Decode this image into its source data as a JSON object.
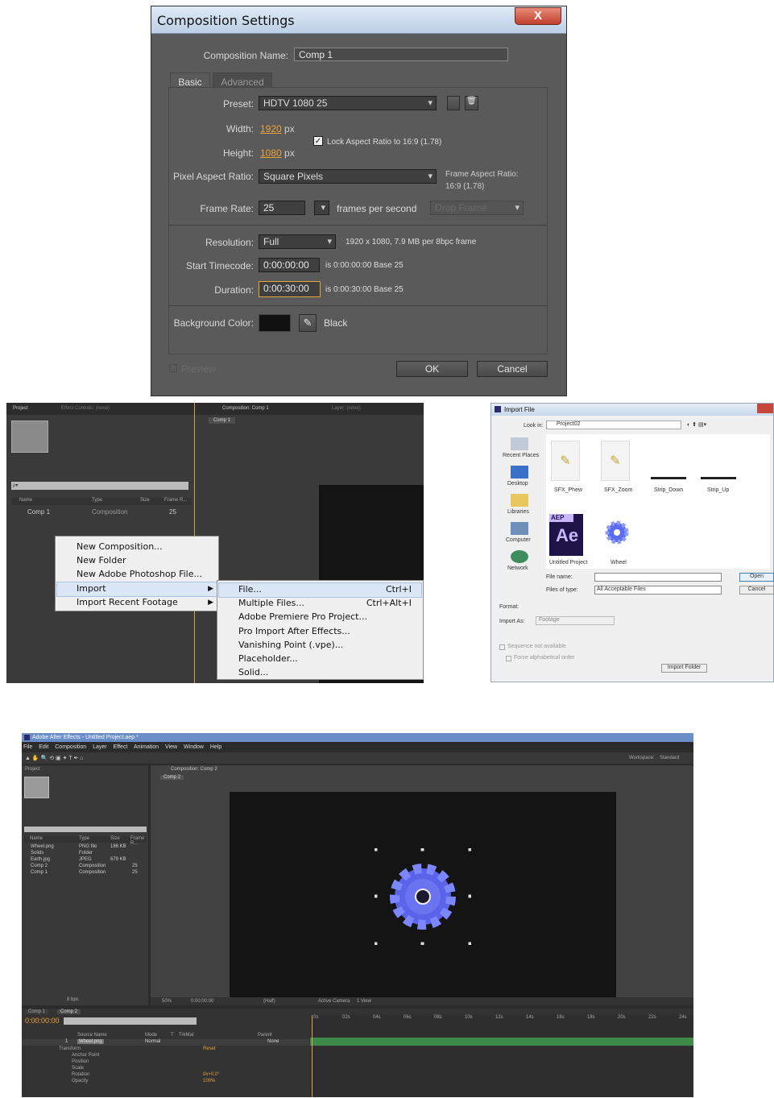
{
  "comp_settings": {
    "title": "Composition Settings",
    "close": "X",
    "comp_name_label": "Composition Name:",
    "comp_name_value": "Comp 1",
    "tabs": [
      "Basic",
      "Advanced"
    ],
    "preset_label": "Preset:",
    "preset_value": "HDTV 1080 25",
    "width_label": "Width:",
    "width_value": "1920",
    "height_label": "Height:",
    "height_value": "1080",
    "px": "px",
    "lock_aspect": "Lock Aspect Ratio to 16:9 (1.78)",
    "par_label": "Pixel Aspect Ratio:",
    "par_value": "Square Pixels",
    "frame_aspect_label": "Frame Aspect Ratio:",
    "frame_aspect_value": "16:9 (1.78)",
    "frame_rate_label": "Frame Rate:",
    "frame_rate_value": "25",
    "fps_label": "frames per second",
    "drop_frame": "Drop Frame",
    "resolution_label": "Resolution:",
    "resolution_value": "Full",
    "resolution_info": "1920 x 1080, 7.9 MB per 8bpc frame",
    "start_tc_label": "Start Timecode:",
    "start_tc_value": "0:00:00:00",
    "start_tc_info": "is 0:00:00:00  Base 25",
    "duration_label": "Duration:",
    "duration_value": "0:00:30:00",
    "duration_info": "is 0:00:30:00  Base 25",
    "bg_label": "Background Color:",
    "bg_name": "Black",
    "preview": "Preview",
    "ok": "OK",
    "cancel": "Cancel"
  },
  "project_panel": {
    "tab_project": "Project",
    "tab_effect": "Effect Controls: (none)",
    "tab_comp": "Composition: Comp 1",
    "tab_layer": "Layer: (none)",
    "comp_chip": "Comp 1",
    "search": "ρ▾",
    "cols": [
      "Name",
      "Type",
      "Size",
      "Frame R..."
    ],
    "row": {
      "name": "Comp 1",
      "type": "Composition",
      "fr": "25"
    }
  },
  "context_menu": {
    "items": [
      "New Composition...",
      "New Folder",
      "New Adobe Photoshop File...",
      "Import",
      "Import Recent Footage"
    ]
  },
  "import_submenu": {
    "items": [
      {
        "label": "File...",
        "shortcut": "Ctrl+I"
      },
      {
        "label": "Multiple Files...",
        "shortcut": "Ctrl+Alt+I"
      },
      {
        "label": "Adobe Premiere Pro Project...",
        "shortcut": ""
      },
      {
        "label": "Pro Import After Effects...",
        "shortcut": ""
      },
      {
        "label": "Vanishing Point (.vpe)...",
        "shortcut": ""
      },
      {
        "label": "Placeholder...",
        "shortcut": ""
      },
      {
        "label": "Solid...",
        "shortcut": ""
      }
    ]
  },
  "import_dialog": {
    "title": "Import File",
    "look_in_label": "Look in:",
    "look_in_value": "Project02",
    "places": [
      "Recent Places",
      "Desktop",
      "Libraries",
      "Computer",
      "Network"
    ],
    "files": [
      "SFX_Phew",
      "SFX_Zoom",
      "Strip_Down",
      "Strip_Up",
      "Untitled Project",
      "Wheel"
    ],
    "aep_label": "AEP",
    "ae_label": "Ae",
    "file_name_label": "File name:",
    "files_of_type_label": "Files of type:",
    "files_of_type_value": "All Acceptable Files",
    "open": "Open",
    "cancel": "Cancel",
    "format_label": "Format:",
    "import_as_label": "Import As:",
    "import_as_value": "Footage",
    "sequence": "Sequence not available",
    "force_alpha": "Force alphabetical order",
    "import_folder": "Import Folder"
  },
  "ae_app": {
    "title": "Adobe After Effects - Untitled Project.aep *",
    "menu": [
      "File",
      "Edit",
      "Composition",
      "Layer",
      "Effect",
      "Animation",
      "View",
      "Window",
      "Help"
    ],
    "workspace_label": "Workspace:",
    "workspace_value": "Standard",
    "project_tab": "Project",
    "comp_tab": "Composition: Comp 2",
    "comp_chip": "Comp 2",
    "cols": [
      "Name",
      "Type",
      "Size",
      "Frame R..."
    ],
    "rows": [
      {
        "name": "Wheel.png",
        "type": "PNG file",
        "size": "186 KB",
        "fr": ""
      },
      {
        "name": "Solids",
        "type": "Folder",
        "size": "",
        "fr": ""
      },
      {
        "name": "Earth.jpg",
        "type": "JPEG",
        "size": "679 KB",
        "fr": ""
      },
      {
        "name": "Comp 2",
        "type": "Composition",
        "size": "",
        "fr": "25"
      },
      {
        "name": "Comp 1",
        "type": "Composition",
        "size": "",
        "fr": "25"
      }
    ],
    "bpc": "8 bpc",
    "zoom": "50%",
    "timecode_view": "0:00:00:00",
    "resolution": "(Half)",
    "active_camera": "Active Camera",
    "view_count": "1 View",
    "tl_tabs": [
      "Comp 1",
      "Comp 2"
    ],
    "tl_timecode": "0:00:00:00",
    "tl_cols": [
      "Source Name",
      "Mode",
      "T",
      "TrkMat",
      "Parent"
    ],
    "layer_num": "1",
    "layer_name": "Wheel.png",
    "layer_mode": "Normal",
    "parent_value": "None",
    "props": [
      "Transform",
      "Anchor Point",
      "Position",
      "Scale",
      "Rotation",
      "Opacity"
    ],
    "reset": "Reset",
    "prop_values": [
      "0x+0.0°",
      "100%"
    ],
    "ruler": [
      "0s",
      "02s",
      "04s",
      "06s",
      "08s",
      "10s",
      "12s",
      "14s",
      "16s",
      "18s",
      "20s",
      "22s",
      "24s"
    ]
  }
}
